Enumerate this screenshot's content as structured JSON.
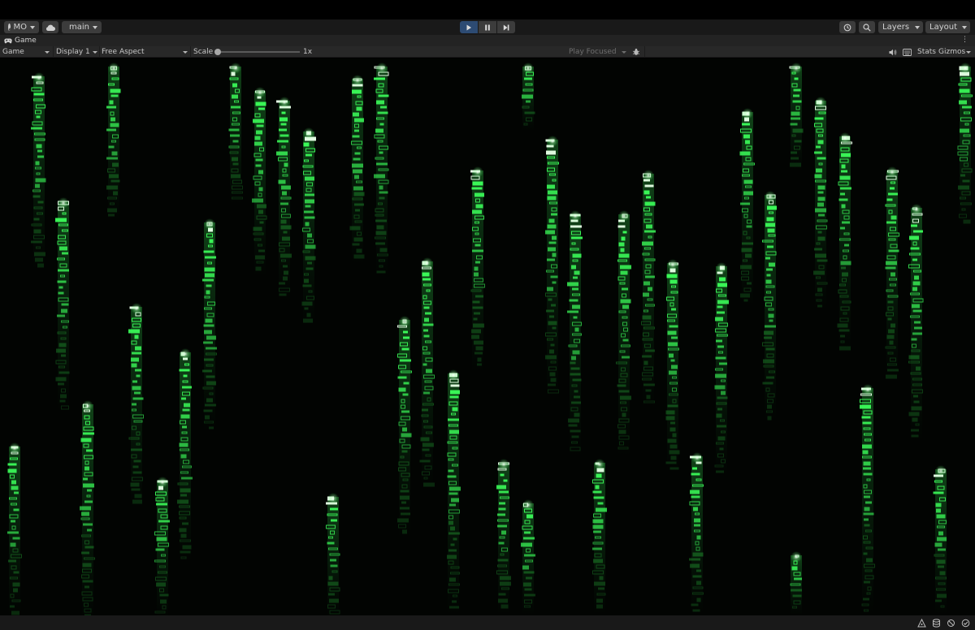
{
  "toolbar": {
    "account": "MO",
    "branch": "main",
    "layers": "Layers",
    "layout": "Layout"
  },
  "tab": {
    "title": "Game"
  },
  "game_bar": {
    "view_mode": "Game",
    "display": "Display 1",
    "aspect": "Free Aspect",
    "scale_label": "Scale",
    "scale_value": "1x",
    "play_mode": "Play Focused",
    "stats": "Stats",
    "gizmos": "Gizmos"
  },
  "colors": {
    "rain_head": "#e6ffe6",
    "rain_bright": "#3cff5a",
    "rain_dim": "#1f8a2c",
    "play_active": "#2d4b73"
  }
}
